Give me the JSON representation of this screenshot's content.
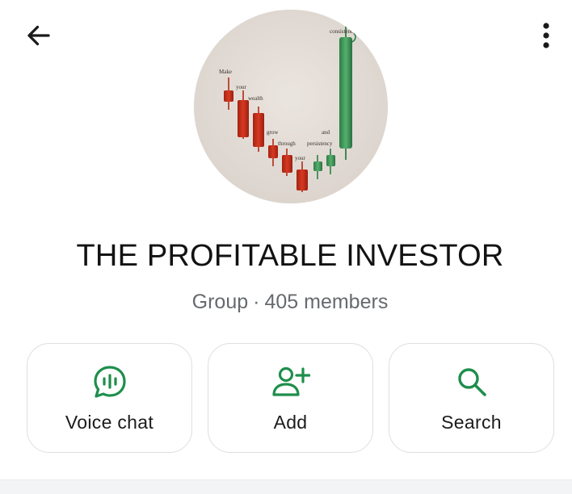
{
  "header": {
    "back_icon": "arrow-left-icon",
    "more_icon": "more-vertical-icon"
  },
  "avatar": {
    "words": [
      "Make",
      "your",
      "wealth",
      "grow",
      "through",
      "your",
      "persistency",
      "and",
      "consistency"
    ]
  },
  "group": {
    "name": "THE PROFITABLE INVESTOR",
    "type": "Group",
    "separator": "·",
    "members": "405 members"
  },
  "actions": [
    {
      "label": "Voice chat",
      "icon": "voice-chat-icon"
    },
    {
      "label": "Add",
      "icon": "add-person-icon"
    },
    {
      "label": "Search",
      "icon": "search-icon"
    }
  ],
  "colors": {
    "accent": "#1e8e4c",
    "text": "#121212",
    "muted": "#666a6e",
    "card_border": "#dcdfe2",
    "candle_red": "#c4301c",
    "candle_green": "#3f9a5a",
    "avatar_bg": "#e3dcd6"
  }
}
